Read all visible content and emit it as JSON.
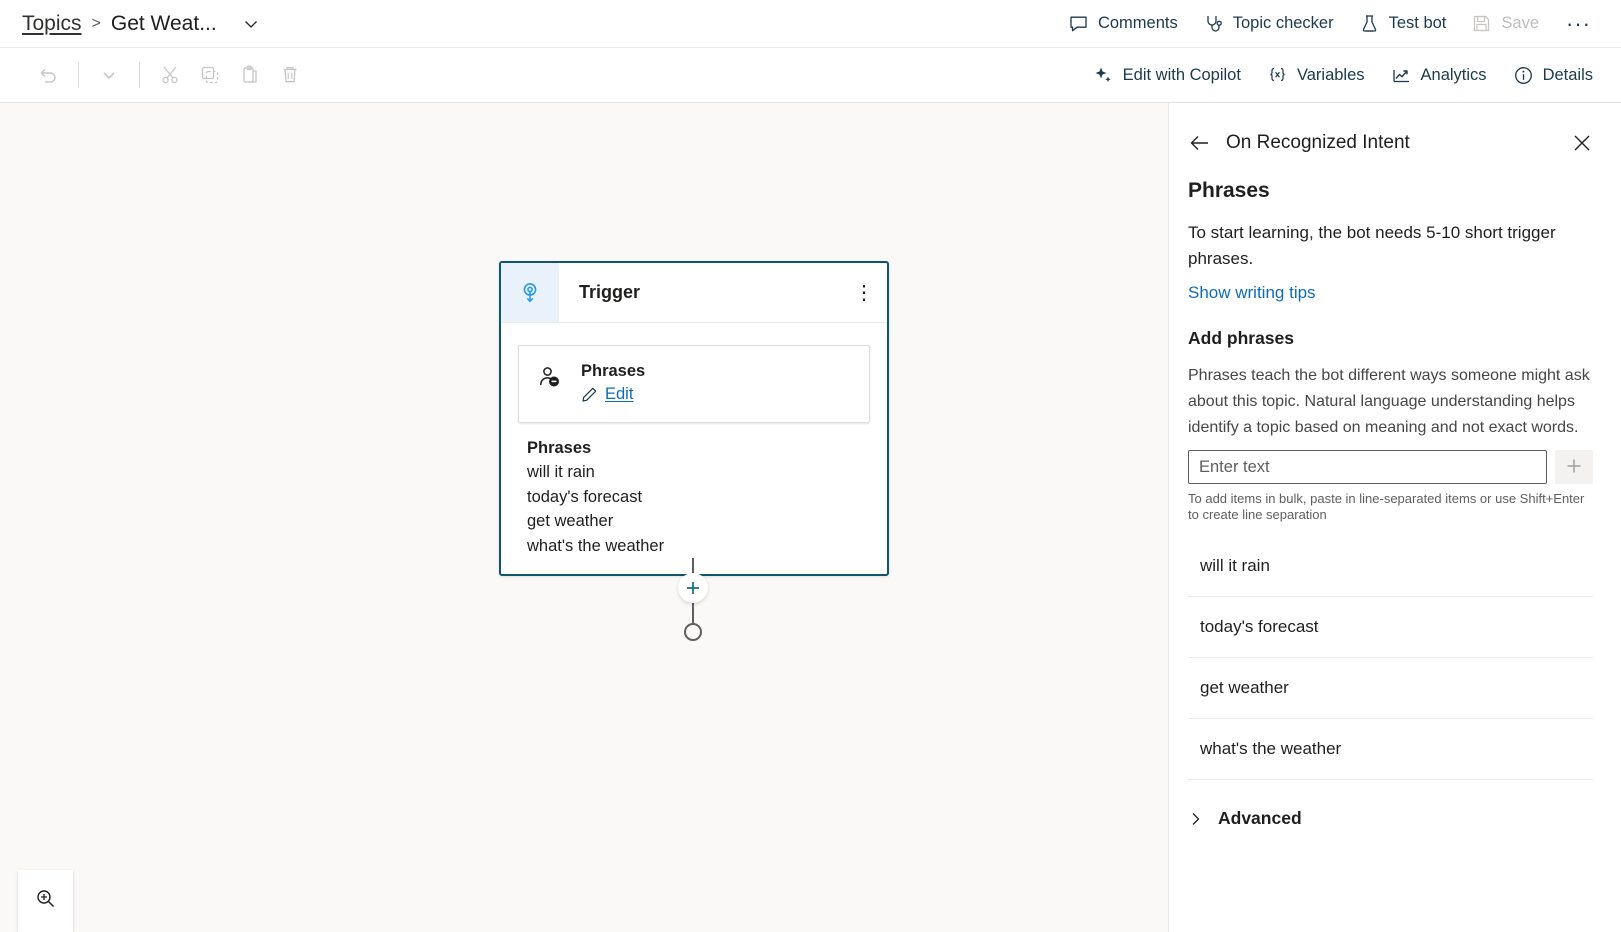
{
  "topbar": {
    "breadcrumb": {
      "root": "Topics",
      "separator": ">",
      "current": "Get Weat...",
      "caret_icon": "chevron-down-icon"
    },
    "commands": [
      {
        "label": "Comments",
        "icon": "comment-icon",
        "disabled": false
      },
      {
        "label": "Topic checker",
        "icon": "stethoscope-icon",
        "disabled": false
      },
      {
        "label": "Test bot",
        "icon": "flask-icon",
        "disabled": false
      },
      {
        "label": "Save",
        "icon": "save-icon",
        "disabled": true
      }
    ],
    "overflow_label": "···"
  },
  "toolbar": {
    "left_icons": [
      {
        "name": "undo-icon",
        "disabled": true
      },
      {
        "name": "chevron-down-icon",
        "disabled": true
      },
      {
        "name": "cut-icon",
        "disabled": true
      },
      {
        "name": "copy-icon",
        "disabled": true
      },
      {
        "name": "paste-icon",
        "disabled": true
      },
      {
        "name": "delete-icon",
        "disabled": true
      }
    ],
    "right_commands": [
      {
        "label": "Edit with Copilot",
        "icon": "sparkle-icon"
      },
      {
        "label": "Variables",
        "icon": "braces-x-icon"
      },
      {
        "label": "Analytics",
        "icon": "trend-chart-icon"
      },
      {
        "label": "Details",
        "icon": "info-circle-icon"
      }
    ]
  },
  "canvas": {
    "node": {
      "trigger_icon": "trigger-icon",
      "title": "Trigger",
      "menu_icon": "more-vertical-icon",
      "subcard": {
        "icon": "person-chat-icon",
        "title": "Phrases",
        "edit_label": "Edit",
        "edit_icon": "pencil-icon"
      },
      "phrases_header": "Phrases",
      "phrases": [
        "will it rain",
        "today's forecast",
        "get weather",
        "what's the weather"
      ]
    },
    "connector": {
      "add_node_icon": "plus-icon",
      "end_icon": "end-node-circle"
    },
    "zoom_control": {
      "icon": "zoom-in-icon"
    }
  },
  "panel": {
    "back_icon": "arrow-left-icon",
    "header_title": "On Recognized Intent",
    "close_icon": "close-icon",
    "section_title": "Phrases",
    "lead_text": "To start learning, the bot needs 5-10 short trigger phrases.",
    "writing_tips_link": "Show writing tips",
    "add_heading": "Add phrases",
    "add_description": "Phrases teach the bot different ways someone might ask about this topic. Natural language understanding helps identify a topic based on meaning and not exact words.",
    "input": {
      "value": "",
      "placeholder": "Enter text"
    },
    "add_button_icon": "plus-icon",
    "bulk_hint": "To add items in bulk, paste in line-separated items or use Shift+Enter to create line separation",
    "phrases": [
      "will it rain",
      "today's forecast",
      "get weather",
      "what's the weather"
    ],
    "advanced": {
      "label": "Advanced",
      "chevron_icon": "chevron-right-icon"
    }
  },
  "colors": {
    "accent_teal": "#0f556c",
    "link_blue": "#0f6cbd",
    "trigger_blue": "#2196f3",
    "canvas_bg": "#faf9f8",
    "node_icon_bg": "#e9f2fb"
  }
}
